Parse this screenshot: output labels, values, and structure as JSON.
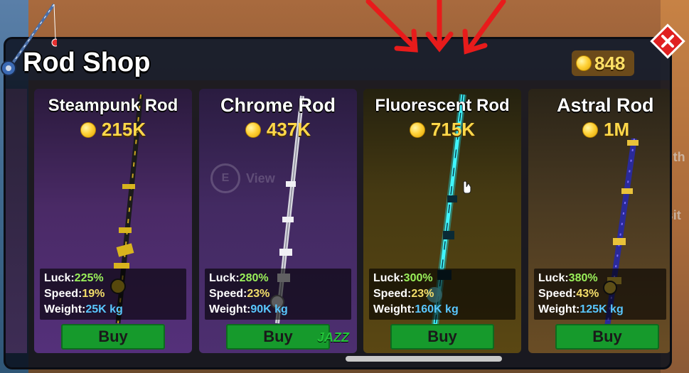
{
  "shop": {
    "title": "Rod Shop",
    "coins": "848",
    "close_label": "✕"
  },
  "background": {
    "talk_text": "Talk to th",
    "visit_text": "Visit",
    "view_key": "E",
    "view_text": "View",
    "watermark": "JAZZ"
  },
  "cards": [
    {
      "name": "Steampunk Rod",
      "price": "215K",
      "luck_label": "Luck:",
      "luck": "225%",
      "speed_label": "Speed:",
      "speed": "19%",
      "weight_label": "Weight:",
      "weight": "25K kg",
      "buy_label": "Buy"
    },
    {
      "name": "Chrome Rod",
      "price": "437K",
      "luck_label": "Luck:",
      "luck": "280%",
      "speed_label": "Speed:",
      "speed": "23%",
      "weight_label": "Weight:",
      "weight": "90K kg",
      "buy_label": "Buy"
    },
    {
      "name": "Fluorescent Rod",
      "price": "715K",
      "luck_label": "Luck:",
      "luck": "300%",
      "speed_label": "Speed:",
      "speed": "23%",
      "weight_label": "Weight:",
      "weight": "160K kg",
      "buy_label": "Buy"
    },
    {
      "name": "Astral Rod",
      "price": "1M",
      "luck_label": "Luck:",
      "luck": "380%",
      "speed_label": "Speed:",
      "speed": "43%",
      "weight_label": "Weight:",
      "weight": "125K kg",
      "buy_label": "Buy"
    }
  ],
  "colors": {
    "buy_button": "#169a2c",
    "coin": "#ffd23a",
    "close_button": "#e02020",
    "luck_value": "#9af05a",
    "speed_value": "#f4de6a",
    "weight_value": "#59c7ff"
  },
  "icons": [
    "coin-icon",
    "close-icon",
    "fishing-rod-icon",
    "arrow-icon",
    "cursor-icon",
    "help-icon"
  ]
}
